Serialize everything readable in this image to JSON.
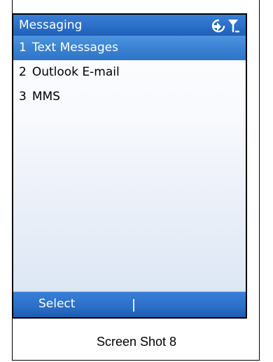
{
  "window": {
    "title": "Messaging"
  },
  "status_icons": [
    "sync-icon",
    "signal-antenna-icon"
  ],
  "menu": {
    "items": [
      {
        "number": "1",
        "label": "Text Messages",
        "selected": true
      },
      {
        "number": "2",
        "label": "Outlook E-mail",
        "selected": false
      },
      {
        "number": "3",
        "label": "MMS",
        "selected": false
      }
    ]
  },
  "softkeys": {
    "left_label": "Select",
    "right_label": ""
  },
  "caption": "Screen Shot 8",
  "colors": {
    "accent": "#2a6fc8",
    "highlight": "#3b82d3",
    "background": "#ffffff"
  }
}
